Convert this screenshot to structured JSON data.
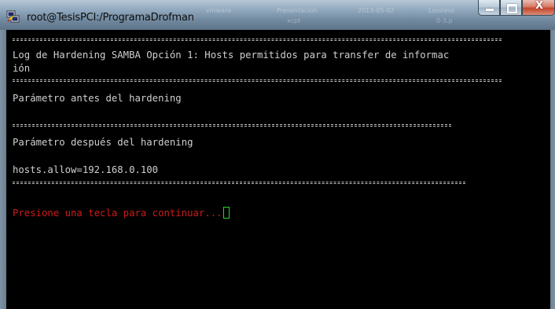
{
  "window": {
    "title": "root@TesisPCI:/ProgramaDrofman",
    "background_ghost_items": [
      "vmware",
      "Presentacion",
      "xcpt",
      "2013-05-02",
      "Lossless",
      "0-3.p"
    ],
    "close_glyph": "X"
  },
  "terminal": {
    "lines": {
      "log_title_1": "Log de Hardening SAMBA Opción 1: Hosts permitidos para transfer de informac",
      "log_title_2": "ión",
      "before_label": "Parámetro antes del hardening",
      "after_label": "Parámetro después del hardening",
      "hosts_allow": "hosts.allow=192.168.0.100",
      "prompt": "Presione una tecla para continuar..."
    },
    "colors": {
      "text": "#cfcfcf",
      "prompt": "#d11a1a",
      "cursor": "#2fd12f",
      "background": "#000000"
    }
  }
}
